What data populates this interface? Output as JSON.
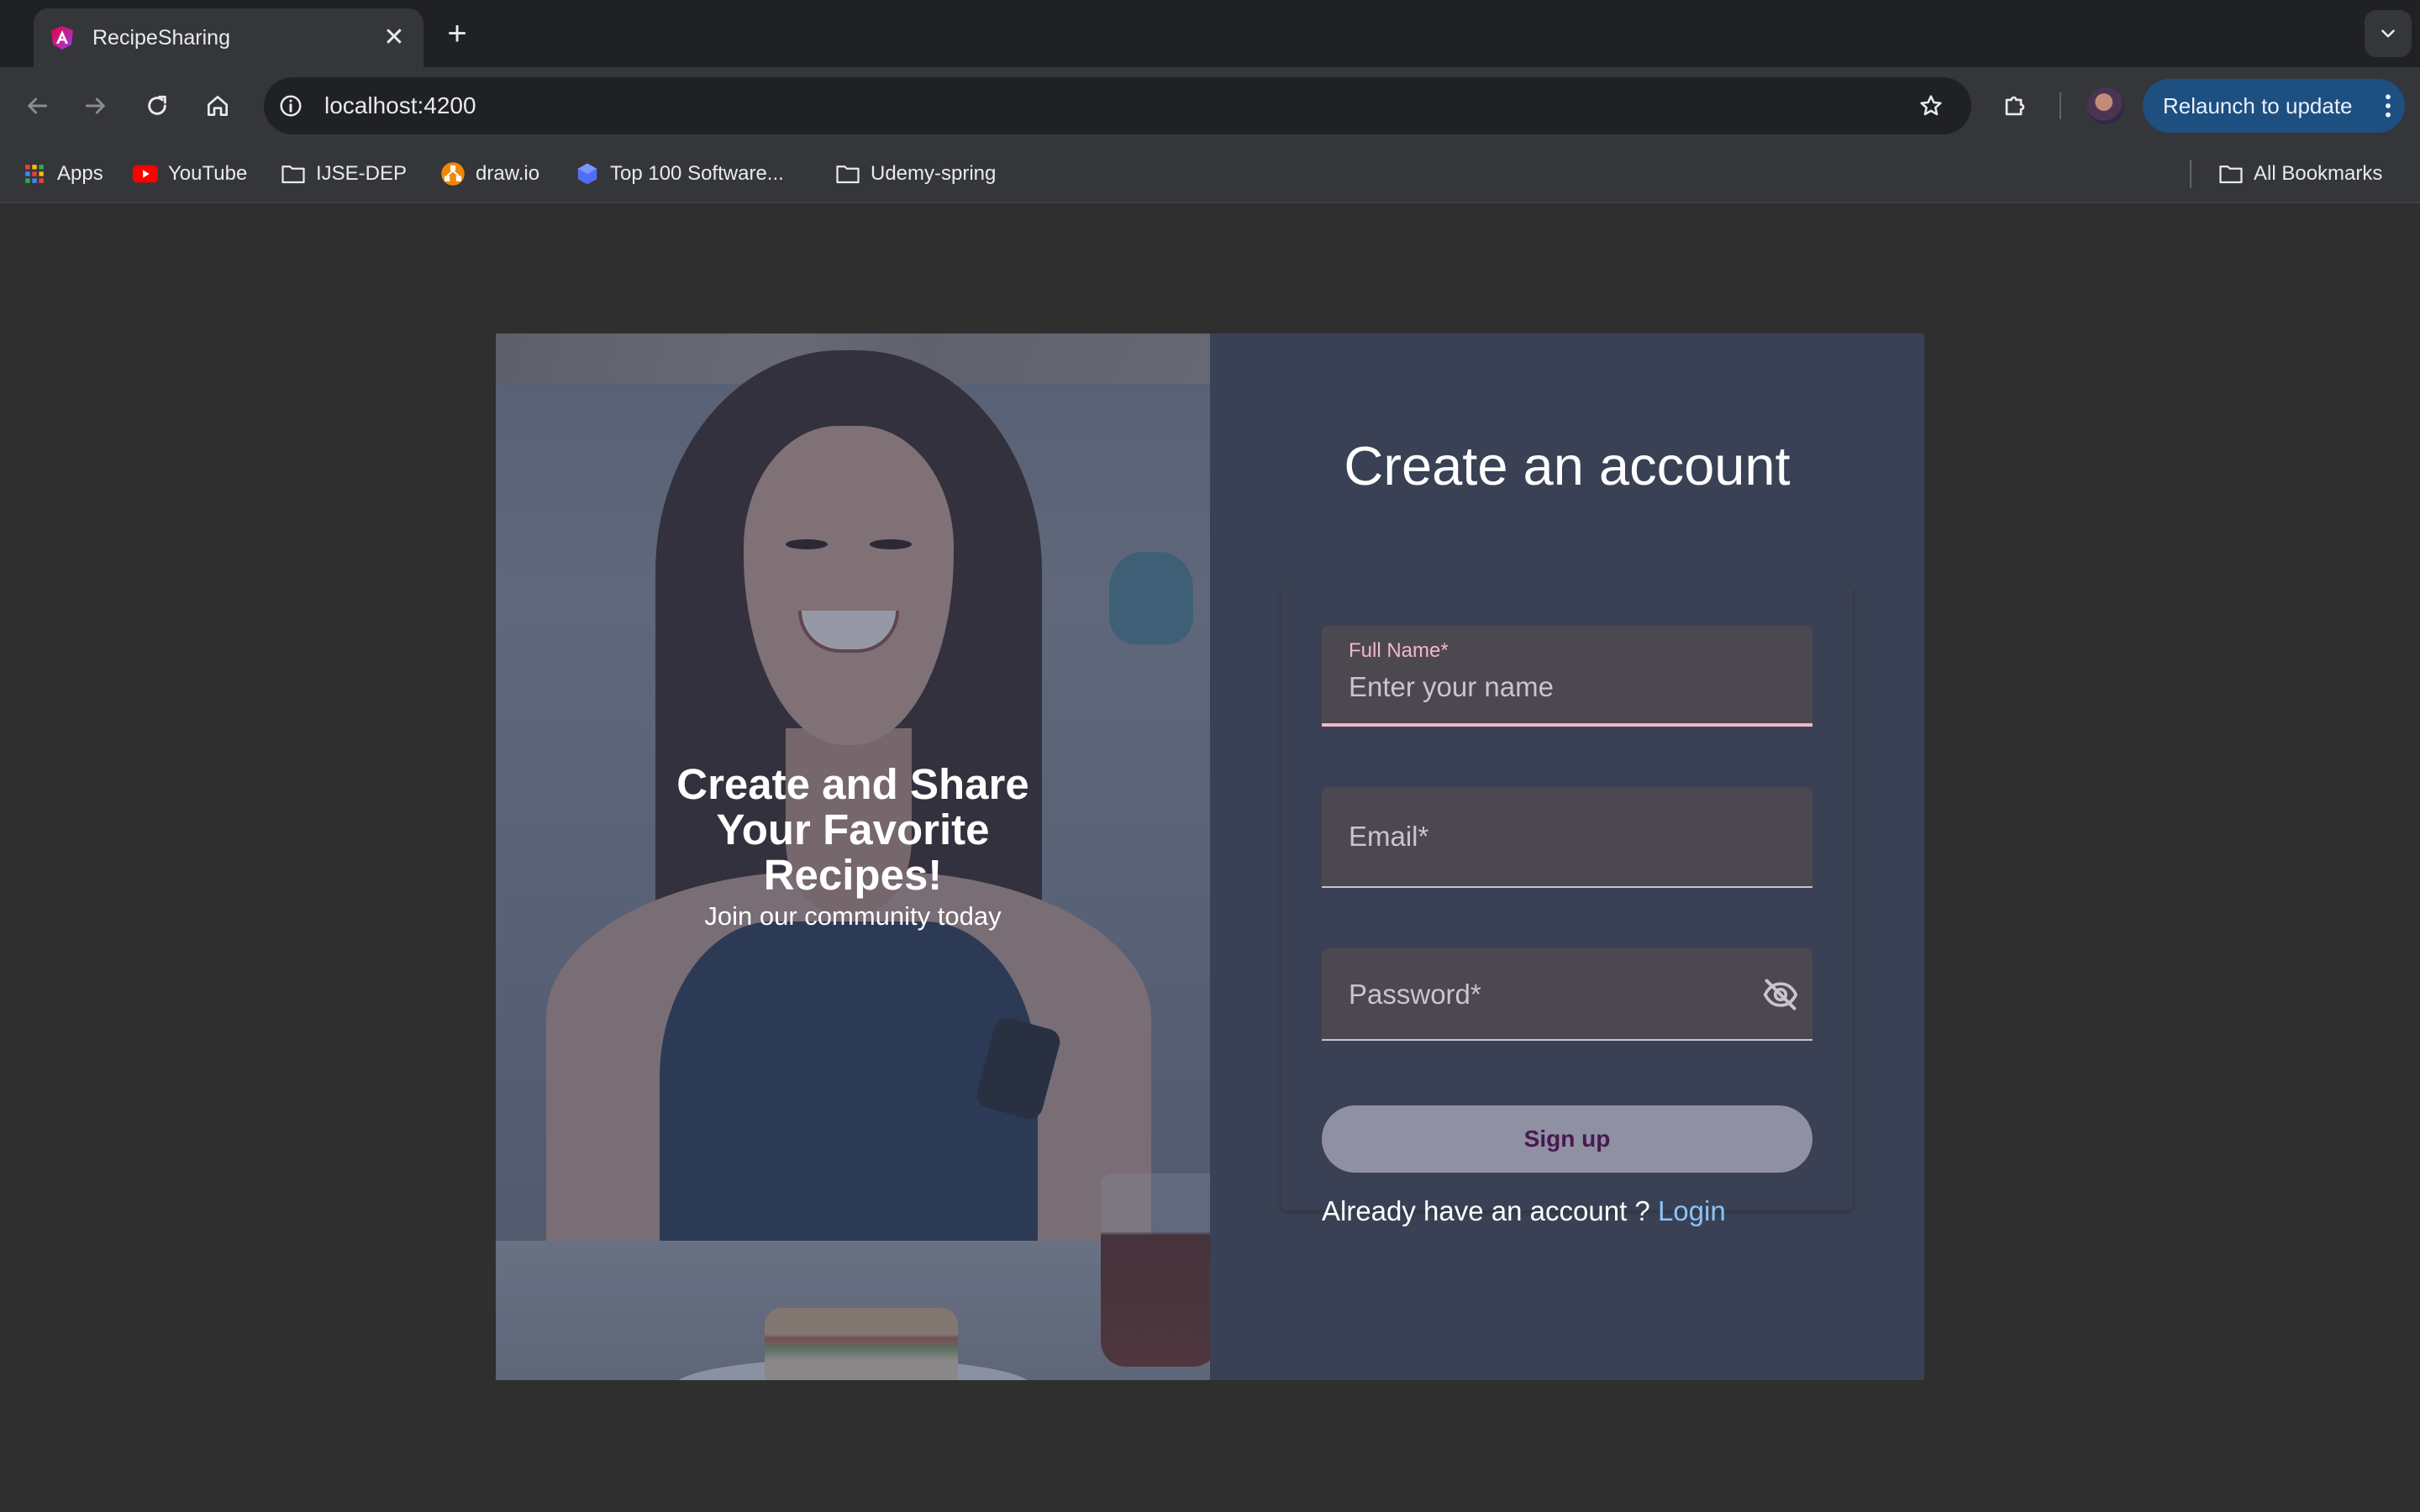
{
  "browser": {
    "tab_title": "RecipeSharing",
    "tab_close_glyph": "✕",
    "new_tab_glyph": "+",
    "url": "localhost:4200",
    "relaunch_label": "Relaunch to update",
    "relaunch_color": "#1d4f80",
    "icons": {
      "favicon": "angular-icon",
      "back": "arrow-left-icon",
      "forward": "arrow-right-icon",
      "reload": "reload-icon",
      "home": "home-icon",
      "site_info": "info-icon",
      "bookmark_star": "star-icon",
      "extensions": "puzzle-icon",
      "menu": "kebab-menu-icon",
      "tab_search": "chevron-down-icon"
    }
  },
  "bookmarks": {
    "items": [
      {
        "label": "Apps",
        "icon": "apps-grid-icon"
      },
      {
        "label": "YouTube",
        "icon": "youtube-icon"
      },
      {
        "label": "IJSE-DEP",
        "icon": "folder-icon"
      },
      {
        "label": "draw.io",
        "icon": "drawio-icon"
      },
      {
        "label": "Top 100 Software...",
        "icon": "hexagon-icon"
      },
      {
        "label": "Udemy-spring",
        "icon": "folder-icon"
      }
    ],
    "all_bookmarks": {
      "label": "All Bookmarks",
      "icon": "folder-icon"
    }
  },
  "hero": {
    "heading": "Create and Share Your Favorite Recipes!",
    "subheading": "Join our community today"
  },
  "form": {
    "title": "Create an account",
    "full_name": {
      "label": "Full Name*",
      "placeholder": "Enter your name",
      "value": ""
    },
    "email": {
      "label": "Email*",
      "value": ""
    },
    "password": {
      "label": "Password*",
      "value": "",
      "toggle_icon": "eye-off-icon"
    },
    "signup_label": "Sign up",
    "login_prompt": "Already have an account ?",
    "login_link": "Login"
  },
  "colors": {
    "page_bg": "#2f2f2f",
    "form_panel_bg": "#3a4154",
    "field_bg": "#4c4850",
    "focus_accent": "#f2b8c6",
    "signup_bg": "#8f91a3",
    "signup_text": "#4a1850",
    "link": "#8ac3f7"
  }
}
